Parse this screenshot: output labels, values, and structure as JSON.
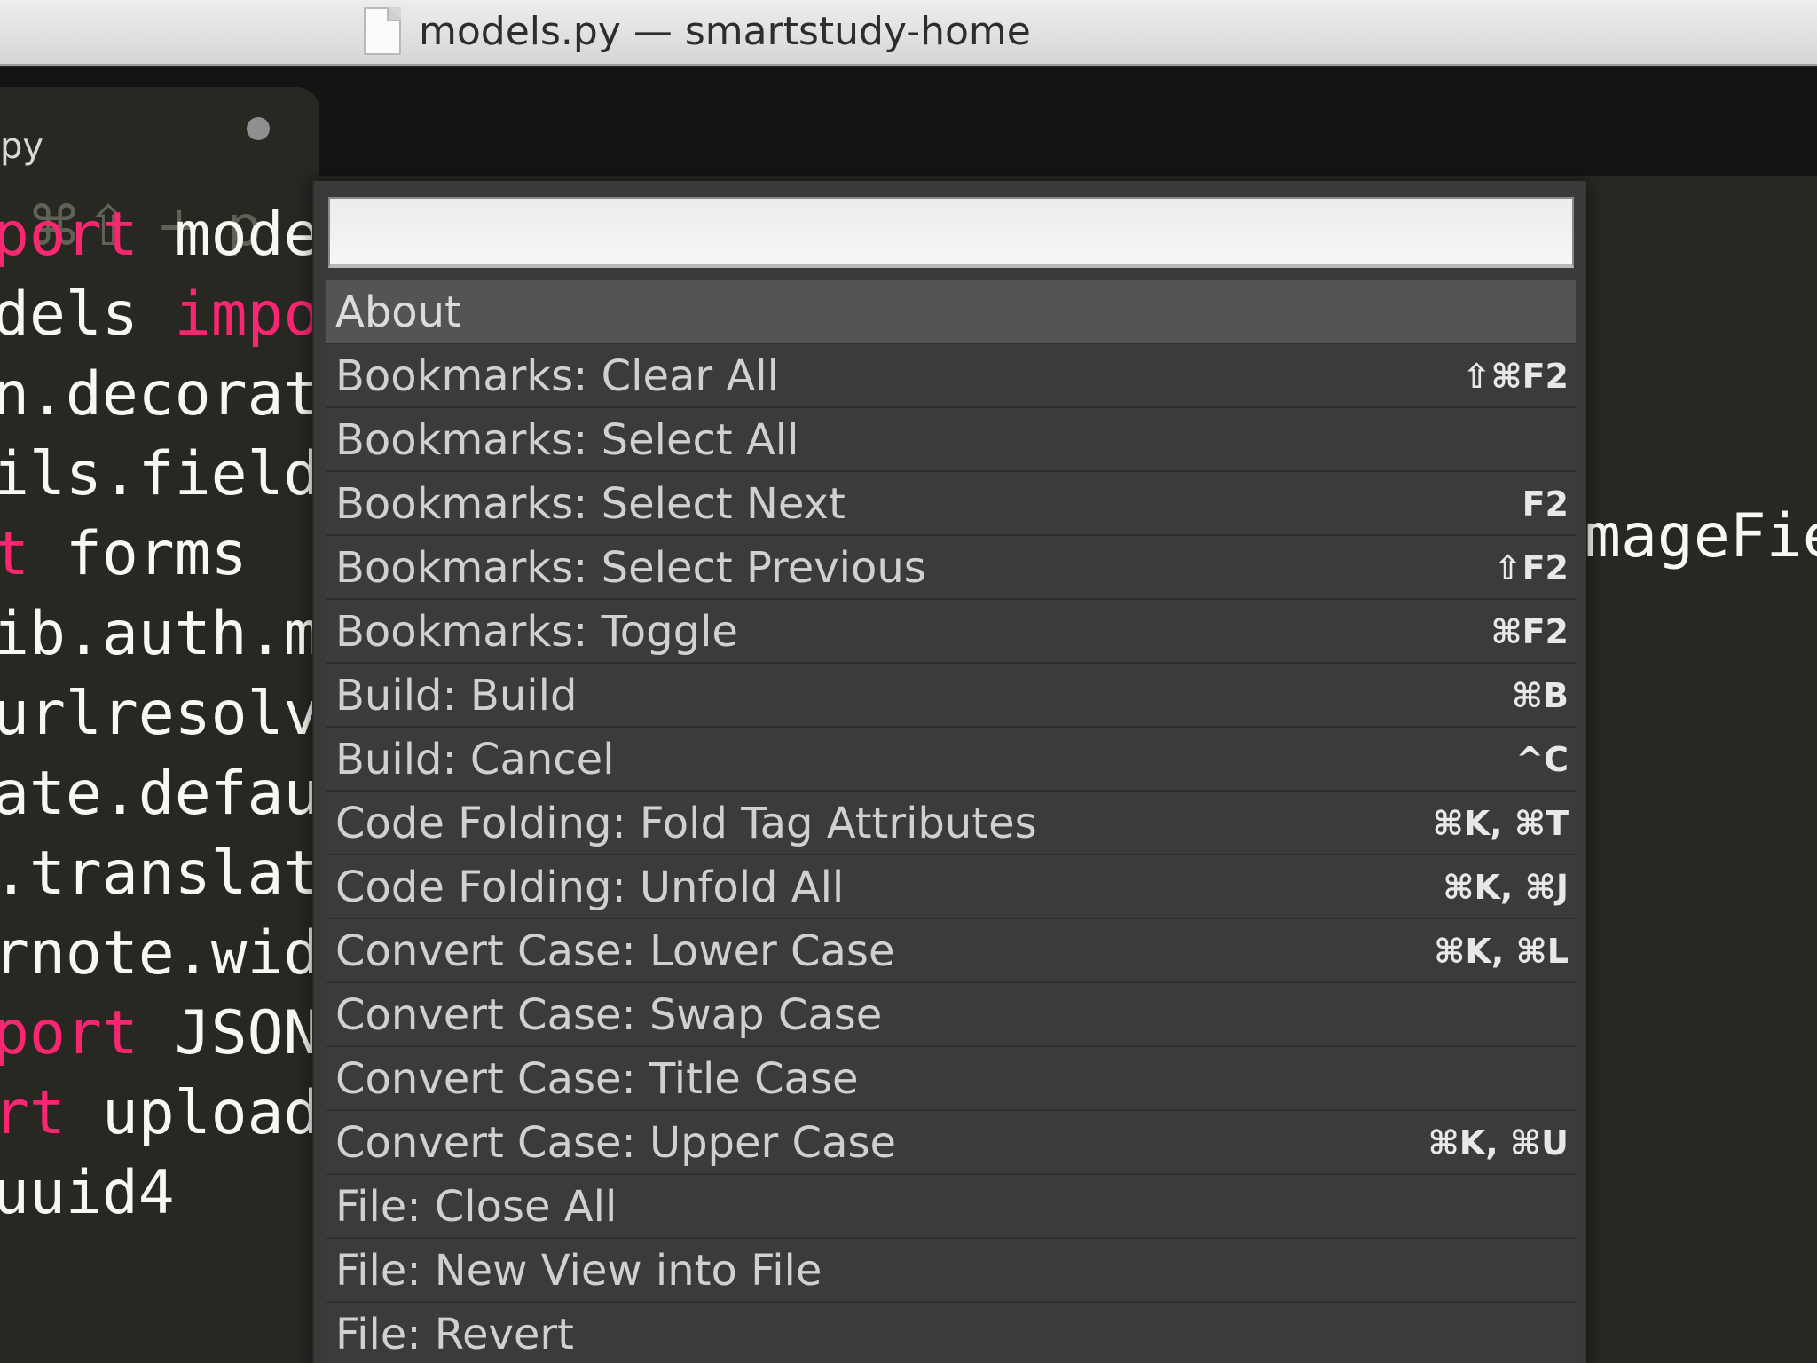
{
  "window": {
    "title": "models.py — smartstudy-home",
    "doc_icon": "document-icon"
  },
  "tab": {
    "label": "py",
    "dirty_icon": "unsaved-dot-icon"
  },
  "editor": {
    "shortcut_hint": "⌘⇧ + p",
    "lines": [
      {
        "pre": "",
        "kw": "port",
        "post": " mode"
      },
      {
        "pre": "dels ",
        "kw": "impo",
        "post": ""
      },
      {
        "pre": "n.decorat",
        "kw": "",
        "post": ""
      },
      {
        "pre": "ils.field",
        "kw": "",
        "post": ""
      },
      {
        "pre": "",
        "kw": "t",
        "post": " forms"
      },
      {
        "pre": "ib.auth.m",
        "kw": "",
        "post": ""
      },
      {
        "pre": "urlresolv",
        "kw": "",
        "post": ""
      },
      {
        "pre": "ate.defau",
        "kw": "",
        "post": ""
      },
      {
        "pre": ".translat",
        "kw": "",
        "post": ""
      },
      {
        "pre": "rnote.wid",
        "kw": "",
        "post": ""
      },
      {
        "pre": "",
        "kw": "port",
        "post": " JSON"
      },
      {
        "pre": "",
        "kw": "rt",
        "post": " upload"
      },
      {
        "pre": "uuid4",
        "kw": "",
        "post": ""
      }
    ],
    "right_fragment": "mageFie"
  },
  "palette": {
    "search_value": "",
    "items": [
      {
        "label": "About",
        "shortcut": "",
        "selected": true
      },
      {
        "label": "Bookmarks: Clear All",
        "shortcut": "⇧⌘F2"
      },
      {
        "label": "Bookmarks: Select All",
        "shortcut": ""
      },
      {
        "label": "Bookmarks: Select Next",
        "shortcut": "F2"
      },
      {
        "label": "Bookmarks: Select Previous",
        "shortcut": "⇧F2"
      },
      {
        "label": "Bookmarks: Toggle",
        "shortcut": "⌘F2"
      },
      {
        "label": "Build: Build",
        "shortcut": "⌘B"
      },
      {
        "label": "Build: Cancel",
        "shortcut": "^C"
      },
      {
        "label": "Code Folding: Fold Tag Attributes",
        "shortcut": "⌘K, ⌘T"
      },
      {
        "label": "Code Folding: Unfold All",
        "shortcut": "⌘K, ⌘J"
      },
      {
        "label": "Convert Case: Lower Case",
        "shortcut": "⌘K, ⌘L"
      },
      {
        "label": "Convert Case: Swap Case",
        "shortcut": ""
      },
      {
        "label": "Convert Case: Title Case",
        "shortcut": ""
      },
      {
        "label": "Convert Case: Upper Case",
        "shortcut": "⌘K, ⌘U"
      },
      {
        "label": "File: Close All",
        "shortcut": ""
      },
      {
        "label": "File: New View into File",
        "shortcut": ""
      },
      {
        "label": "File: Revert",
        "shortcut": ""
      }
    ]
  },
  "colors": {
    "editor_bg": "#272822",
    "keyword": "#f92672",
    "palette_bg": "#3b3b3b",
    "palette_selected": "#545454"
  }
}
